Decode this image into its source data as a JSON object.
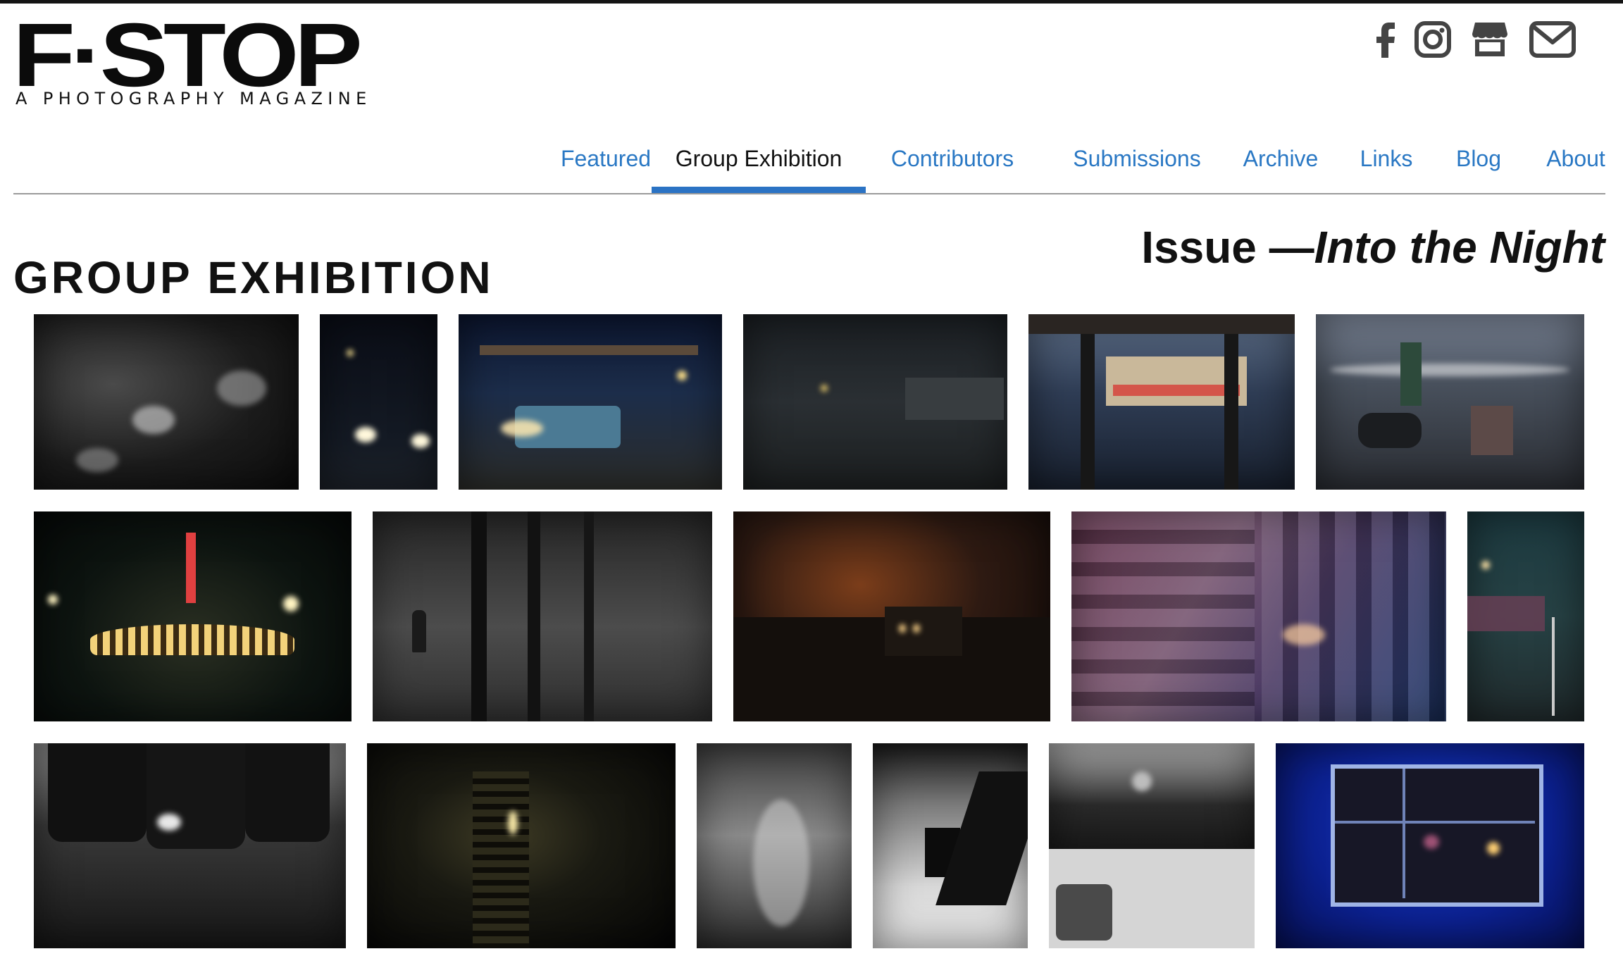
{
  "brand": {
    "logo_text": "F·STOP",
    "tagline": "A PHOTOGRAPHY MAGAZINE"
  },
  "social": [
    {
      "name": "facebook-icon",
      "label": "Facebook"
    },
    {
      "name": "instagram-icon",
      "label": "Instagram"
    },
    {
      "name": "shop-icon",
      "label": "Shop"
    },
    {
      "name": "email-icon",
      "label": "Email"
    }
  ],
  "nav": {
    "items": [
      {
        "label": "Featured",
        "active": false
      },
      {
        "label": "Group Exhibition",
        "active": true
      },
      {
        "label": "Contributors",
        "active": false
      },
      {
        "label": "Submissions",
        "active": false
      },
      {
        "label": "Archive",
        "active": false
      },
      {
        "label": "Links",
        "active": false
      },
      {
        "label": "Blog",
        "active": false
      },
      {
        "label": "About",
        "active": false
      }
    ]
  },
  "page": {
    "title": "GROUP EXHIBITION",
    "issue_prefix": "Issue —",
    "issue_name": "Into the Night"
  },
  "colors": {
    "link": "#2a78c4",
    "active_underline": "#2b73c4",
    "text": "#111111"
  },
  "gallery": {
    "photos": [
      {
        "name": "photo-crowd-hands-bw"
      },
      {
        "name": "photo-foggy-street-headlights"
      },
      {
        "name": "photo-pickup-truck-garage"
      },
      {
        "name": "photo-foggy-town"
      },
      {
        "name": "photo-coney-island-pigeons"
      },
      {
        "name": "photo-night-market-motorbikes"
      },
      {
        "name": "photo-tower-diner-neon"
      },
      {
        "name": "photo-misty-forest-figure"
      },
      {
        "name": "photo-house-fire-glow"
      },
      {
        "name": "photo-hong-kong-apartments"
      },
      {
        "name": "photo-street-corner-night"
      },
      {
        "name": "photo-women-legs-bw"
      },
      {
        "name": "photo-dancer-stairs"
      },
      {
        "name": "photo-abstract-blur-bw"
      },
      {
        "name": "photo-street-lamp-bw"
      },
      {
        "name": "photo-car-roof-bw"
      },
      {
        "name": "photo-blue-window-woman"
      }
    ]
  }
}
